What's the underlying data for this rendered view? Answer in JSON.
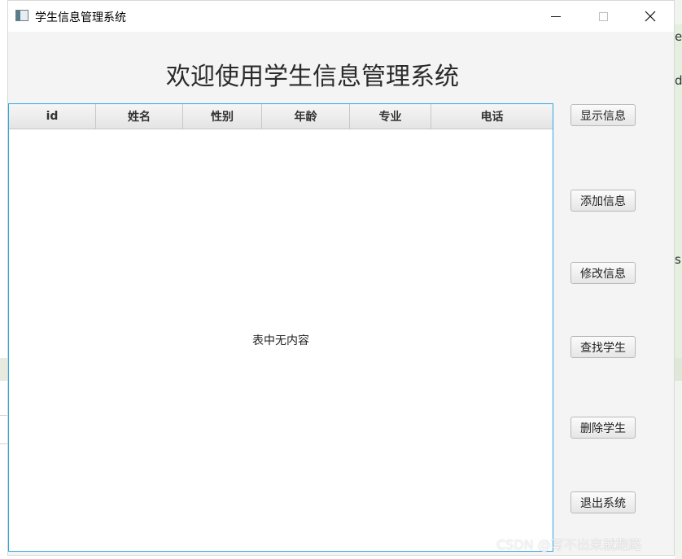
{
  "window": {
    "title": "学生信息管理系统"
  },
  "main": {
    "heading": "欢迎使用学生信息管理系统"
  },
  "table": {
    "columns": [
      "id",
      "姓名",
      "性别",
      "年龄",
      "专业",
      "电话"
    ],
    "empty_message": "表中无内容"
  },
  "buttons": {
    "show": "显示信息",
    "add": "添加信息",
    "edit": "修改信息",
    "find": "查找学生",
    "delete": "删除学生",
    "exit": "退出系统"
  },
  "background": {
    "glyph_top": "er",
    "glyph_mid": "d",
    "glyph_low": "s"
  },
  "watermark": "CSDN @写不出来就跑路",
  "colors": {
    "table_border": "#2ea6e0",
    "window_bg": "#f4f4f4"
  },
  "icons": {
    "app": "app-window-icon",
    "minimize": "minimize-icon",
    "maximize": "maximize-icon",
    "close": "close-icon"
  }
}
